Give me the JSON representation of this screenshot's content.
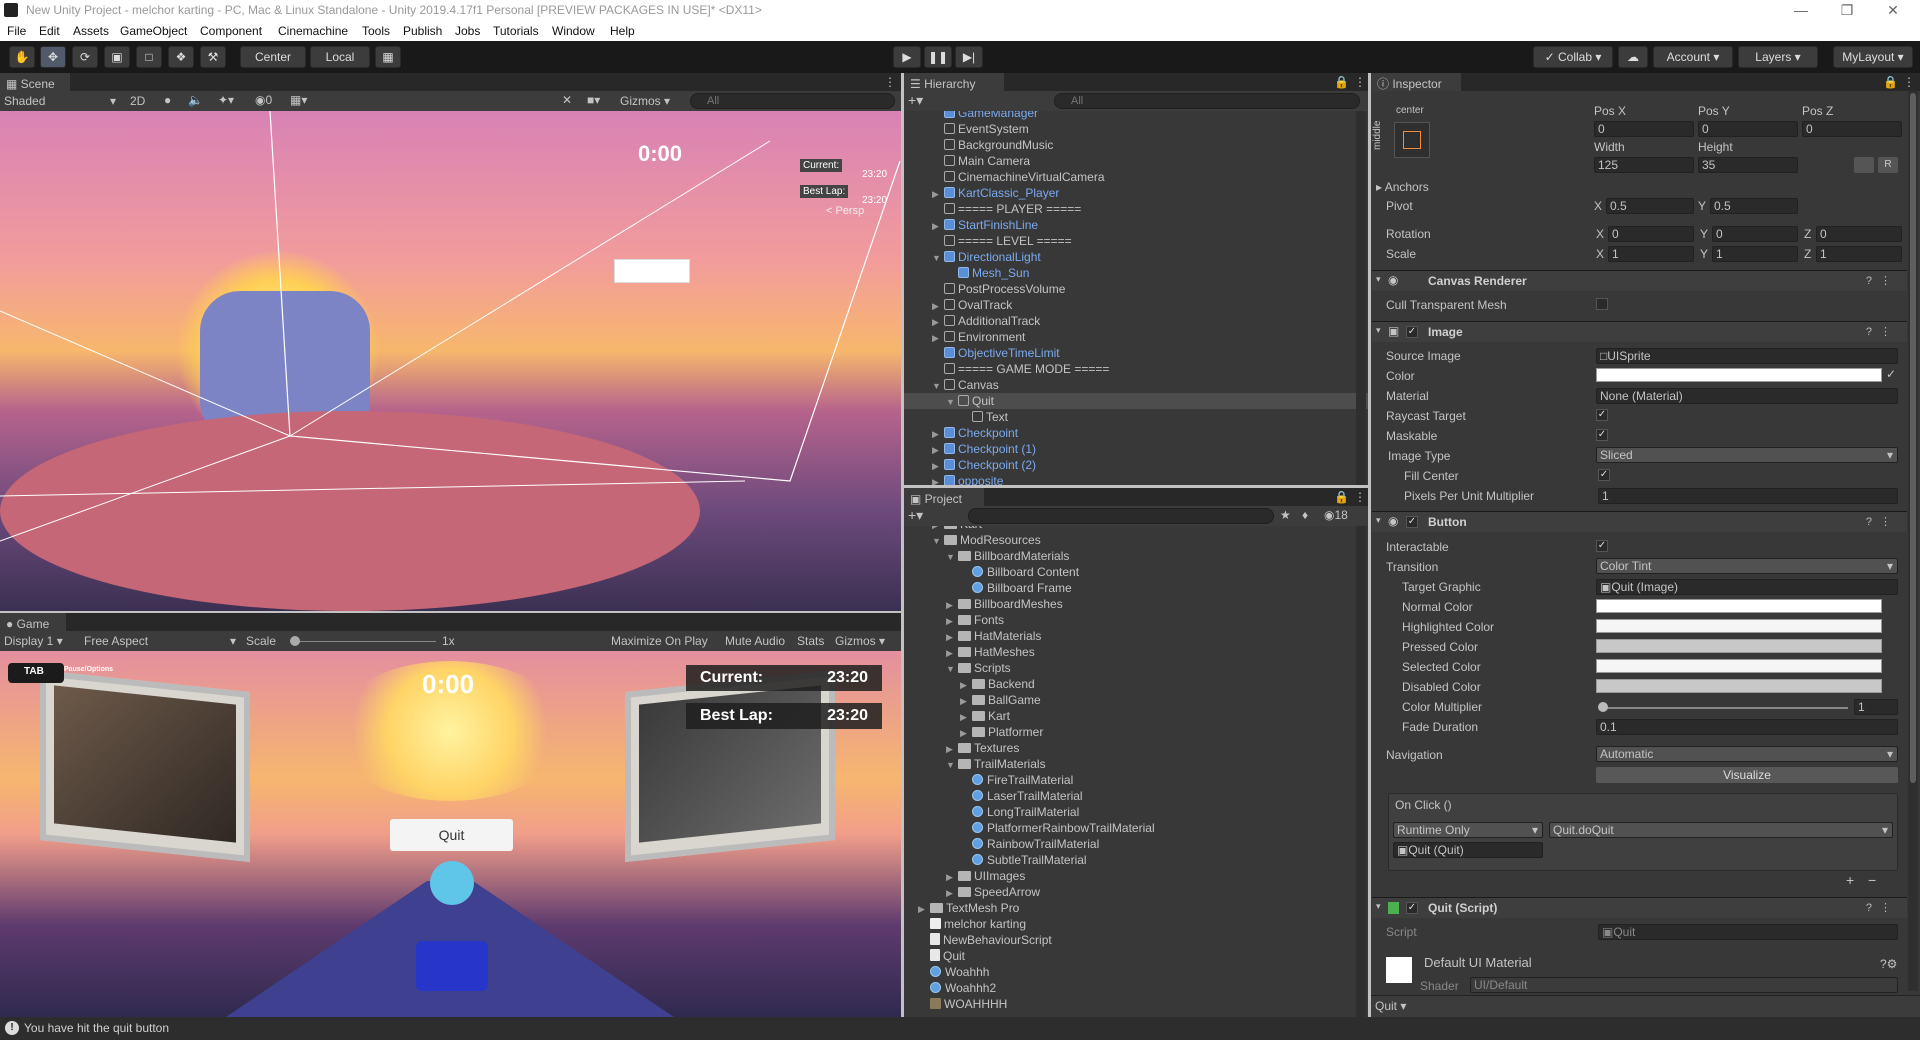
{
  "window": {
    "title": "New Unity Project - melchor karting - PC, Mac & Linux Standalone - Unity 2019.4.17f1 Personal [PREVIEW PACKAGES IN USE]* <DX11>"
  },
  "menu": [
    "File",
    "Edit",
    "Assets",
    "GameObject",
    "Component",
    "Cinemachine",
    "Tools",
    "Publish",
    "Jobs",
    "Tutorials",
    "Window",
    "Help"
  ],
  "toolbar": {
    "center_label": "Center",
    "local_label": "Local",
    "collab_label": "Collab",
    "account_label": "Account",
    "layers_label": "Layers",
    "layout_label": "MyLayout"
  },
  "scene": {
    "tab": "Scene",
    "shading": "Shaded",
    "mode_2d": "2D",
    "gizmos": "Gizmos",
    "search_placeholder": "All",
    "hidden_count": "0",
    "hud_time": "0:00",
    "persp": "< Persp",
    "current_label": "Current:",
    "best_label": "Best Lap:",
    "mini_time": "23:20"
  },
  "game": {
    "tab": "Game",
    "display": "Display 1",
    "aspect": "Free Aspect",
    "scale_label": "Scale",
    "scale_value": "1x",
    "maximize": "Maximize On Play",
    "mute": "Mute Audio",
    "stats": "Stats",
    "gizmos": "Gizmos",
    "tab_key": "TAB",
    "pause_hint": "Pause/Options",
    "timer": "0:00",
    "current_label": "Current:",
    "current_value": "23:20",
    "best_label": "Best Lap:",
    "best_value": "23:20",
    "quit_button": "Quit"
  },
  "hierarchy": {
    "tab": "Hierarchy",
    "search_placeholder": "All",
    "items": [
      {
        "label": "GameManager",
        "blue": true
      },
      {
        "label": "EventSystem",
        "blue": false
      },
      {
        "label": "BackgroundMusic",
        "blue": false
      },
      {
        "label": "Main Camera",
        "blue": false
      },
      {
        "label": "CinemachineVirtualCamera",
        "blue": false
      },
      {
        "label": "KartClassic_Player",
        "blue": true
      },
      {
        "label": "===== PLAYER =====",
        "blue": false
      },
      {
        "label": "StartFinishLine",
        "blue": true
      },
      {
        "label": "===== LEVEL =====",
        "blue": false
      },
      {
        "label": "DirectionalLight",
        "blue": true
      },
      {
        "label": "Mesh_Sun",
        "blue": true
      },
      {
        "label": "PostProcessVolume",
        "blue": false
      },
      {
        "label": "OvalTrack",
        "blue": false
      },
      {
        "label": "AdditionalTrack",
        "blue": false
      },
      {
        "label": "Environment",
        "blue": false
      },
      {
        "label": "ObjectiveTimeLimit",
        "blue": true
      },
      {
        "label": "===== GAME MODE =====",
        "blue": false
      },
      {
        "label": "Canvas",
        "blue": false
      },
      {
        "label": "Quit",
        "blue": false
      },
      {
        "label": "Text",
        "blue": false
      },
      {
        "label": "Checkpoint",
        "blue": true
      },
      {
        "label": "Checkpoint (1)",
        "blue": true
      },
      {
        "label": "Checkpoint (2)",
        "blue": true
      },
      {
        "label": "opposite",
        "blue": true
      }
    ]
  },
  "project": {
    "tab": "Project",
    "count": "18",
    "items": [
      {
        "label": "Kart",
        "kind": "folder"
      },
      {
        "label": "ModResources",
        "kind": "folder"
      },
      {
        "label": "BillboardMaterials",
        "kind": "folder"
      },
      {
        "label": "Billboard Content",
        "kind": "mat"
      },
      {
        "label": "Billboard Frame",
        "kind": "mat"
      },
      {
        "label": "BillboardMeshes",
        "kind": "folder"
      },
      {
        "label": "Fonts",
        "kind": "folder"
      },
      {
        "label": "HatMaterials",
        "kind": "folder"
      },
      {
        "label": "HatMeshes",
        "kind": "folder"
      },
      {
        "label": "Scripts",
        "kind": "folder"
      },
      {
        "label": "Backend",
        "kind": "folder"
      },
      {
        "label": "BallGame",
        "kind": "folder"
      },
      {
        "label": "Kart",
        "kind": "folder"
      },
      {
        "label": "Platformer",
        "kind": "folder"
      },
      {
        "label": "Textures",
        "kind": "folder"
      },
      {
        "label": "TrailMaterials",
        "kind": "folder"
      },
      {
        "label": "FireTrailMaterial",
        "kind": "mat"
      },
      {
        "label": "LaserTrailMaterial",
        "kind": "mat"
      },
      {
        "label": "LongTrailMaterial",
        "kind": "mat"
      },
      {
        "label": "PlatformerRainbowTrailMaterial",
        "kind": "mat"
      },
      {
        "label": "RainbowTrailMaterial",
        "kind": "mat"
      },
      {
        "label": "SubtleTrailMaterial",
        "kind": "mat"
      },
      {
        "label": "UIImages",
        "kind": "folder"
      },
      {
        "label": "SpeedArrow",
        "kind": "folder"
      },
      {
        "label": "TextMesh Pro",
        "kind": "folder"
      },
      {
        "label": "melchor karting",
        "kind": "scene"
      },
      {
        "label": "NewBehaviourScript",
        "kind": "script"
      },
      {
        "label": "Quit",
        "kind": "script"
      },
      {
        "label": "Woahhh",
        "kind": "mat"
      },
      {
        "label": "Woahhh2",
        "kind": "mat"
      },
      {
        "label": "WOAHHHH",
        "kind": "tex"
      }
    ]
  },
  "inspector": {
    "tab": "Inspector",
    "rect": {
      "anchor_h": "center",
      "anchor_v": "middle",
      "posx_label": "Pos X",
      "posx": "0",
      "posy_label": "Pos Y",
      "posy": "0",
      "posz_label": "Pos Z",
      "posz": "0",
      "width_label": "Width",
      "width": "125",
      "height_label": "Height",
      "height": "35",
      "anchors": "Anchors",
      "pivot": "Pivot",
      "pivot_x": "0.5",
      "pivot_y": "0.5",
      "rotation": "Rotation",
      "rot_x": "0",
      "rot_y": "0",
      "rot_z": "0",
      "scale": "Scale",
      "scale_x": "1",
      "scale_y": "1",
      "scale_z": "1"
    },
    "canvas_renderer": {
      "name": "Canvas Renderer",
      "cull": "Cull Transparent Mesh"
    },
    "image": {
      "name": "Image",
      "source_image": "Source Image",
      "source_value": "UISprite",
      "color": "Color",
      "material": "Material",
      "material_value": "None (Material)",
      "raycast": "Raycast Target",
      "maskable": "Maskable",
      "image_type": "Image Type",
      "image_type_value": "Sliced",
      "fill_center": "Fill Center",
      "ppu": "Pixels Per Unit Multiplier",
      "ppu_value": "1"
    },
    "button": {
      "name": "Button",
      "interactable": "Interactable",
      "transition": "Transition",
      "transition_value": "Color Tint",
      "target_graphic": "Target Graphic",
      "target_value": "Quit (Image)",
      "normal": "Normal Color",
      "highlighted": "Highlighted Color",
      "pressed": "Pressed Color",
      "selected": "Selected Color",
      "disabled": "Disabled Color",
      "multiplier": "Color Multiplier",
      "multiplier_value": "1",
      "fade": "Fade Duration",
      "fade_value": "0.1",
      "navigation": "Navigation",
      "navigation_value": "Automatic",
      "visualize": "Visualize",
      "onclick": "On Click ()",
      "runtime": "Runtime Only",
      "method": "Quit.doQuit",
      "target_obj": "Quit (Quit)"
    },
    "script": {
      "name": "Quit (Script)",
      "label": "Script",
      "value": "Quit"
    },
    "material": {
      "name": "Default UI Material",
      "shader_label": "Shader",
      "shader_value": "UI/Default"
    },
    "footer": "Quit"
  },
  "status": {
    "message": "You have hit the quit button"
  }
}
